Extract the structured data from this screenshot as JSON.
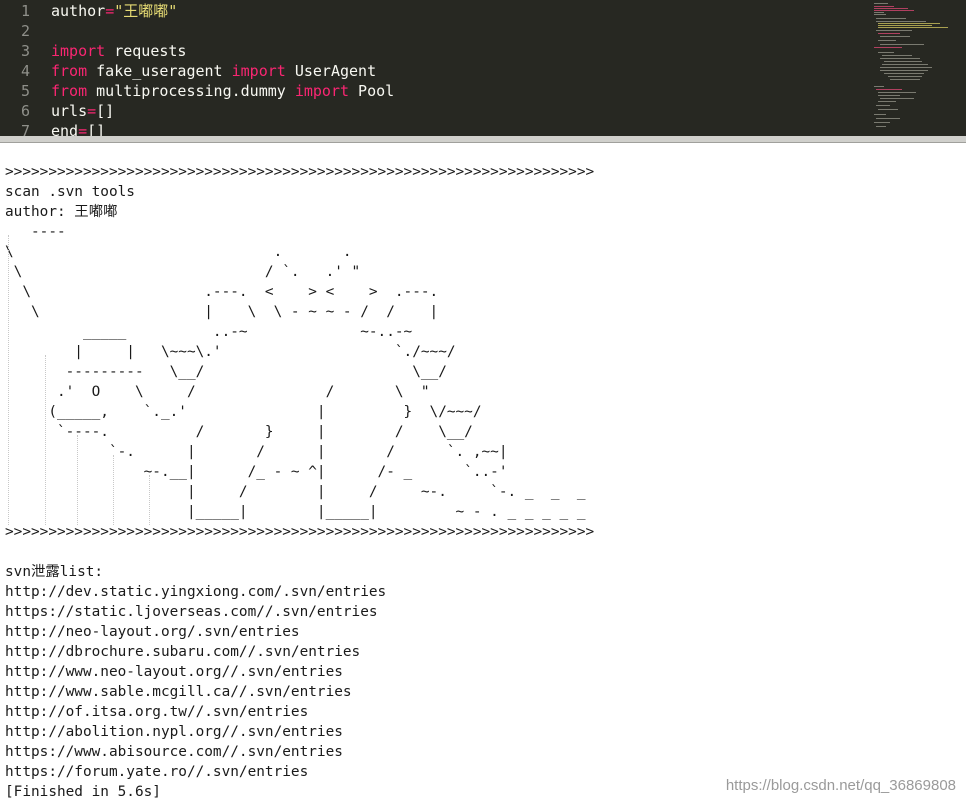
{
  "editor": {
    "lines": [
      {
        "num": "1",
        "tokens": [
          {
            "t": "author",
            "c": "plain"
          },
          {
            "t": "=",
            "c": "op"
          },
          {
            "t": "\"王嘟嘟\"",
            "c": "str"
          }
        ]
      },
      {
        "num": "2",
        "tokens": []
      },
      {
        "num": "3",
        "tokens": [
          {
            "t": "import",
            "c": "kw"
          },
          {
            "t": " requests",
            "c": "plain"
          }
        ]
      },
      {
        "num": "4",
        "tokens": [
          {
            "t": "from",
            "c": "kw"
          },
          {
            "t": " fake_useragent ",
            "c": "plain"
          },
          {
            "t": "import",
            "c": "kw"
          },
          {
            "t": " UserAgent",
            "c": "plain"
          }
        ]
      },
      {
        "num": "5",
        "tokens": [
          {
            "t": "from",
            "c": "kw"
          },
          {
            "t": " multiprocessing.dummy ",
            "c": "plain"
          },
          {
            "t": "import",
            "c": "kw"
          },
          {
            "t": " Pool",
            "c": "plain"
          }
        ]
      },
      {
        "num": "6",
        "tokens": [
          {
            "t": "urls",
            "c": "plain"
          },
          {
            "t": "=",
            "c": "op"
          },
          {
            "t": "[]",
            "c": "plain"
          }
        ]
      },
      {
        "num": "7",
        "tokens": [
          {
            "t": "end",
            "c": "plain"
          },
          {
            "t": "=",
            "c": "op"
          },
          {
            "t": "[]",
            "c": "plain"
          }
        ]
      }
    ]
  },
  "console": {
    "banner_separator": ">>>>>>>>>>>>>>>>>>>>>>>>>>>>>>>>>>>>>>>>>>>>>>>>>>>>>>>>>>>>>>>>>>>>",
    "banner_title": "scan .svn tools",
    "banner_author": "author: 王嘟嘟",
    "ascii_art": "   ----\n\\                              .       .\n \\                            / `.   .' \"\n  \\                    .---.  <    > <    >  .---.\n   \\                   |    \\  \\ - ~ ~ - /  /    |\n         _____          ..-~             ~-..-~\n        |     |   \\~~~\\.'                    `./~~~/\n       ---------   \\__/                        \\__/\n      .'  O    \\     /               /       \\  \"\n     (_____,    `._.'               |         }  \\/~~~/\n      `----.          /       }     |        /    \\__/\n            `-.      |       /      |       /      `. ,~~|\n                ~-.__|      /_ - ~ ^|      /- _      `..-'\n                     |     /        |     /     ~-.     `-. _  _  _\n                     |_____|        |_____|         ~ - . _ _ _ _ _",
    "leak_header": "svn泄露list:",
    "urls": [
      "http://dev.static.yingxiong.com/.svn/entries",
      "https://static.ljoverseas.com//.svn/entries",
      "http://neo-layout.org/.svn/entries",
      "http://dbrochure.subaru.com//.svn/entries",
      "http://www.neo-layout.org//.svn/entries",
      "http://www.sable.mcgill.ca//.svn/entries",
      "http://of.itsa.org.tw//.svn/entries",
      "http://abolition.nypl.org//.svn/entries",
      "https://www.abisource.com//.svn/entries",
      "https://forum.yate.ro//.svn/entries"
    ],
    "finished": "[Finished in 5.6s]"
  },
  "watermark": "https://blog.csdn.net/qq_36869808",
  "colors": {
    "editor_bg": "#272822",
    "keyword": "#f92672",
    "string": "#e6db74",
    "plain": "#f8f8f2",
    "line_number": "#8f908a",
    "console_bg": "#ffffff",
    "console_text": "#1a1a1a"
  }
}
